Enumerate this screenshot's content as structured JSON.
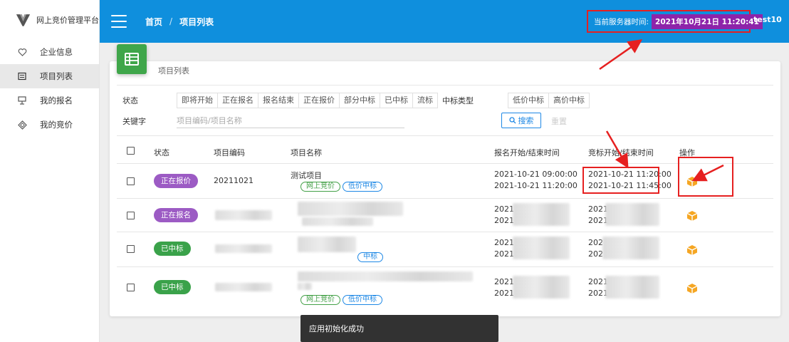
{
  "app": {
    "name": "网上竞价管理平台"
  },
  "sidebar": {
    "items": [
      {
        "label": "企业信息",
        "icon": "heart-icon"
      },
      {
        "label": "项目列表",
        "icon": "list-icon",
        "active": true
      },
      {
        "label": "我的报名",
        "icon": "register-icon"
      },
      {
        "label": "我的竞价",
        "icon": "diamond-icon"
      }
    ]
  },
  "header": {
    "breadcrumb": [
      "首页",
      "项目列表"
    ],
    "breadcrumb_separator": "/",
    "server_time_label": "当前服务器时间:",
    "server_time_value": "2021年10月21日 11:20:41",
    "username": "test10"
  },
  "card": {
    "title": "项目列表"
  },
  "filters": {
    "status_label": "状态",
    "status_options": [
      "即将开始",
      "正在报名",
      "报名结束",
      "正在报价",
      "部分中标",
      "已中标",
      "流标"
    ],
    "win_type_label": "中标类型",
    "win_type_options": [
      "低价中标",
      "高价中标"
    ],
    "keyword_label": "关键字",
    "keyword_placeholder": "项目编码/项目名称",
    "search_label": "搜索",
    "reset_label": "重置"
  },
  "table": {
    "columns": [
      "状态",
      "项目编码",
      "项目名称",
      "报名开始/结束时间",
      "竞标开始/结束时间",
      "操作"
    ],
    "rows": [
      {
        "status": "正在报价",
        "status_color": "#9c5bc4",
        "code": "20211021",
        "name": "测试项目",
        "tags": [
          "网上竞价",
          "低价中标"
        ],
        "signup_start": "2021-10-21 09:00:00",
        "signup_end": "2021-10-21 11:20:00",
        "bid_start": "2021-10-21 11:20:00",
        "bid_end": "2021-10-21 11:45:00"
      },
      {
        "status": "正在报名",
        "status_color": "#9c5bc4",
        "signup_start_partial": "2021",
        "signup_end_partial": "2021",
        "bid_start_partial": "2021",
        "bid_end_partial": "2021"
      },
      {
        "status": "已中标",
        "status_color": "#3aa24a",
        "tags_partial": [
          "中标"
        ],
        "signup_start_partial": "2021",
        "signup_end_partial": "2021",
        "bid_start_partial": "202",
        "bid_end_partial": "202"
      },
      {
        "status": "已中标",
        "status_color": "#3aa24a",
        "tags": [
          "网上竞价",
          "低价中标"
        ],
        "signup_start_partial": "2021",
        "signup_end_partial": "2021",
        "bid_start_partial": "2021",
        "bid_end_partial": "2021"
      }
    ]
  },
  "toast": {
    "message": "应用初始化成功"
  },
  "colors": {
    "header": "#0f8fdd",
    "accent_green": "#3fa64a",
    "annotation_red": "#e62020",
    "op_icon": "#f5a623"
  }
}
